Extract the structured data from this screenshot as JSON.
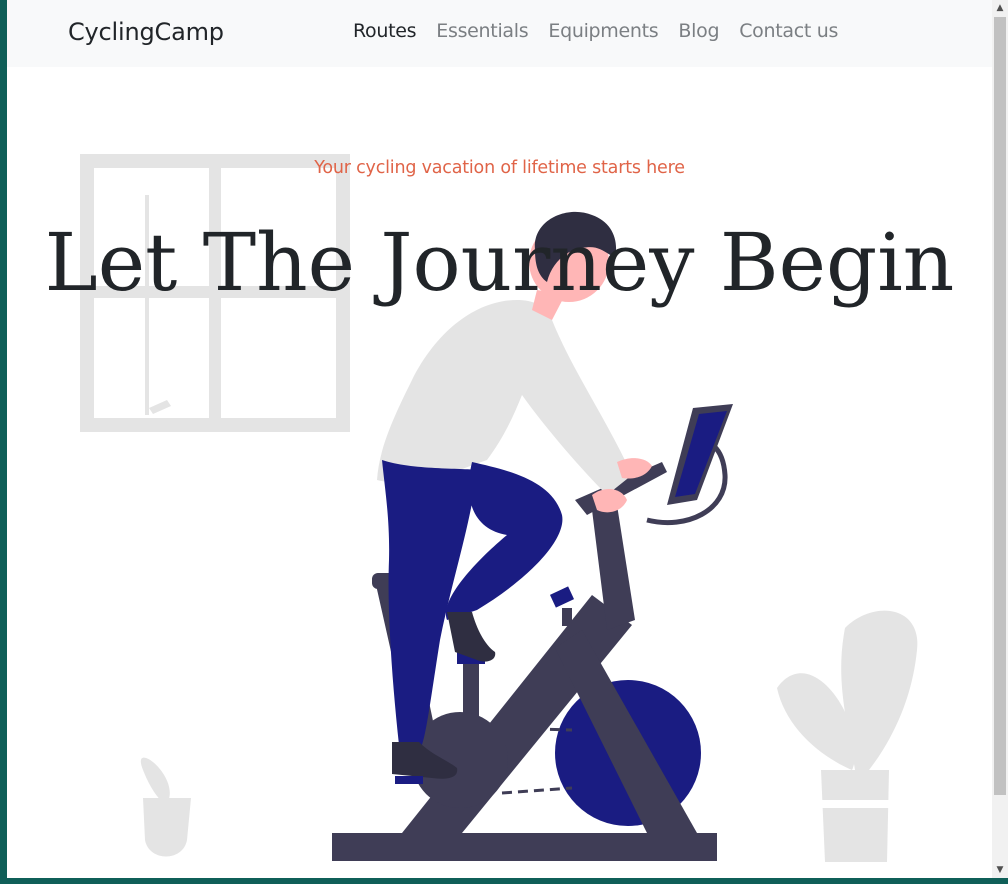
{
  "brand": "CyclingCamp",
  "nav": {
    "items": [
      {
        "label": "Routes",
        "active": true
      },
      {
        "label": "Essentials",
        "active": false
      },
      {
        "label": "Equipments",
        "active": false
      },
      {
        "label": "Blog",
        "active": false
      },
      {
        "label": "Contact us",
        "active": false
      }
    ]
  },
  "hero": {
    "tagline": "Your cycling vacation of lifetime starts here",
    "headline": "Let The Journey Begin"
  },
  "colors": {
    "accent": "#e06448",
    "text": "#212529",
    "bike_dark": "#3f3d56",
    "navy": "#1a1c82",
    "light_gray": "#e4e4e4",
    "skin": "#ffb6b6"
  },
  "icons": [
    "scroll-up-arrow-icon",
    "scroll-down-arrow-icon"
  ]
}
